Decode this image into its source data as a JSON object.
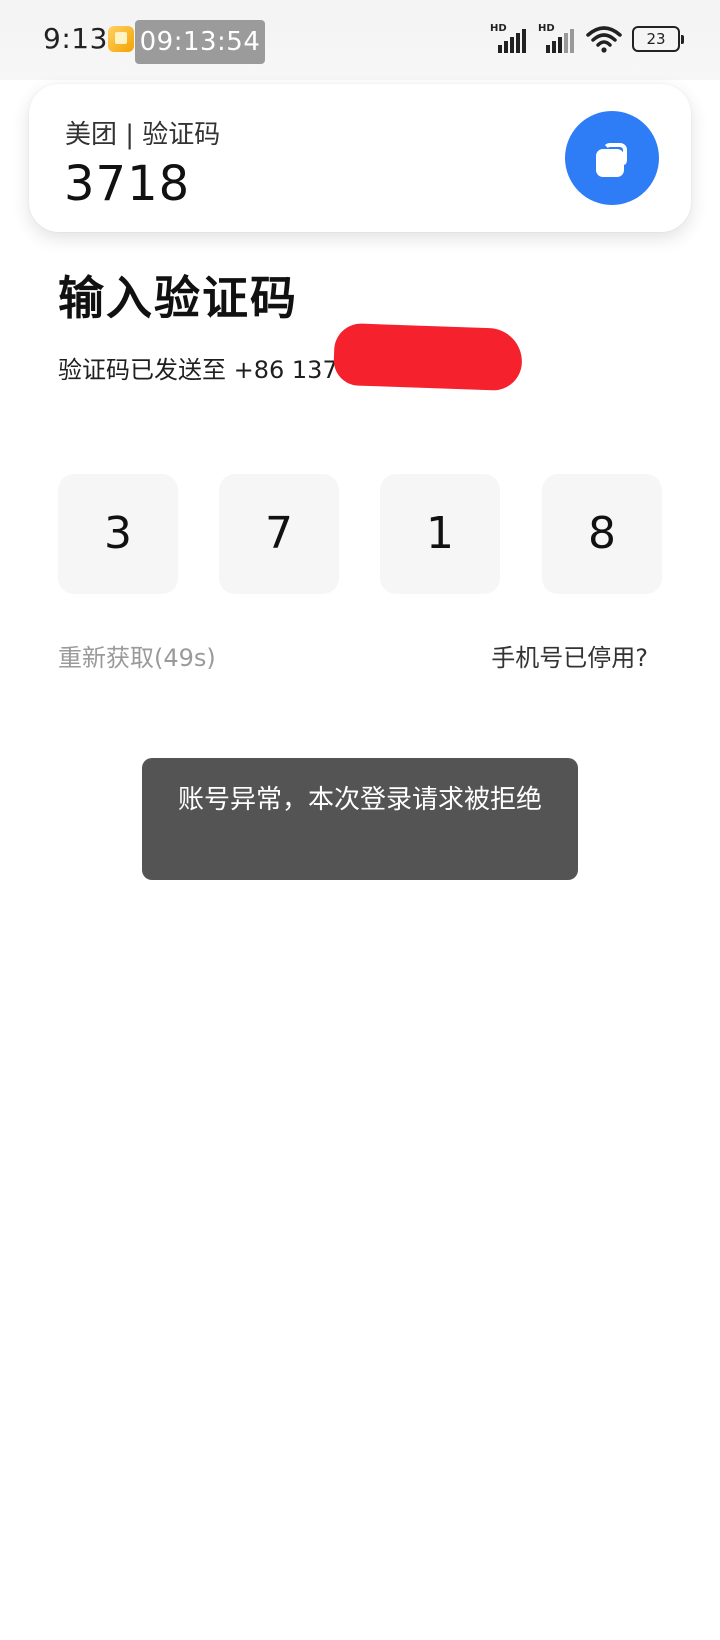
{
  "status_bar": {
    "time": "9:13",
    "recording_timer": "09:13:54",
    "battery_level": "23",
    "icons": [
      "app-notification-icon",
      "signal-hd-icon",
      "signal-hd-icon",
      "wifi-icon",
      "battery-icon"
    ]
  },
  "notification": {
    "source": "美团 | 验证码",
    "code": "3718",
    "action_icon": "copy-icon",
    "accent_color": "#2f7df6"
  },
  "page": {
    "title": "输入验证码",
    "sent_to_prefix": "验证码已发送至 +86 137",
    "code_digits": [
      "3",
      "7",
      "1",
      "8"
    ],
    "resend_label": "重新获取(49s)",
    "phone_disabled_label": "手机号已停用?"
  },
  "toast": {
    "message": "账号异常，本次登录请求被拒绝"
  },
  "colors": {
    "redaction": "#f5222d",
    "toast_bg": "#545454",
    "box_bg": "#f6f6f6"
  }
}
